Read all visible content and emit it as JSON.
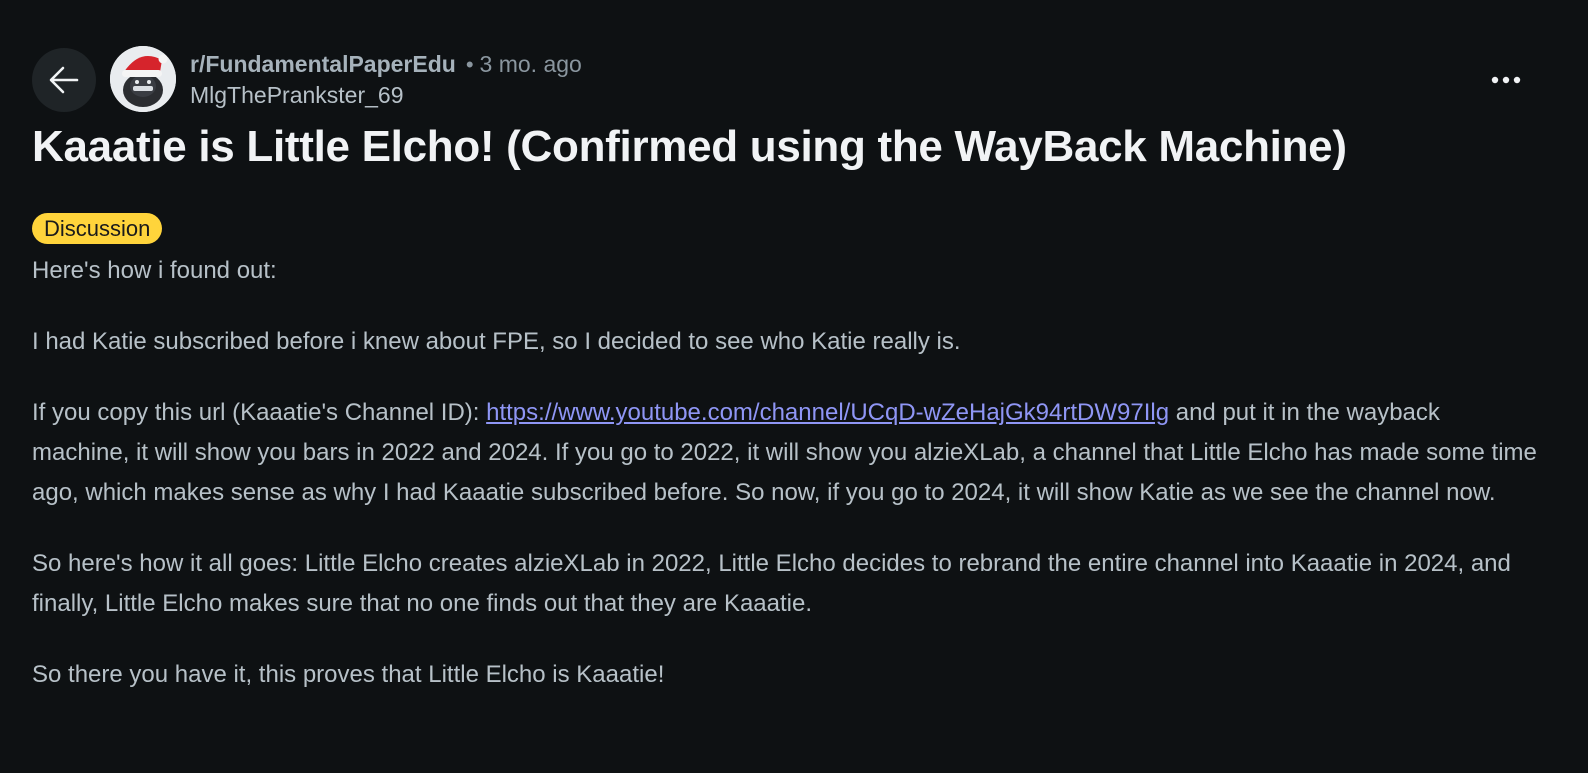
{
  "header": {
    "subreddit": "r/FundamentalPaperEdu",
    "separator": "•",
    "time_ago": "3 mo. ago",
    "username": "MlgThePrankster_69"
  },
  "post": {
    "title": "Kaaatie is Little Elcho! (Confirmed using the WayBack Machine)",
    "flair": "Discussion",
    "flair_color": "#ffd43b",
    "paragraphs": {
      "p1": "Here's how i found out:",
      "p2": "I had Katie subscribed before i knew about FPE, so I decided to see who Katie really is.",
      "p3_before_link": "If you copy this url (Kaaatie's Channel ID): ",
      "p3_link": "https://www.youtube.com/channel/UCqD-wZeHajGk94rtDW97Ilg",
      "p3_after_link": " and put it in the wayback machine, it will show you bars in 2022 and 2024. If you go to 2022, it will show you alzieXLab, a channel that Little Elcho has made some time ago, which makes sense as why I had Kaaatie subscribed before. So now, if you go to 2024, it will show Katie as we see the channel now.",
      "p4": "So here's how it all goes: Little Elcho creates alzieXLab in 2022, Little Elcho decides to rebrand the entire channel into Kaaatie in 2024, and finally, Little Elcho makes sure that no one finds out that they are Kaaatie.",
      "p5": "So there you have it, this proves that Little Elcho is Kaaatie!"
    }
  },
  "icons": {
    "back": "arrow-left-icon",
    "more": "more-horizontal-icon",
    "avatar": "user-avatar"
  },
  "colors": {
    "background": "#0e1113",
    "link": "#8f96f5",
    "title": "#f1f3f5"
  }
}
